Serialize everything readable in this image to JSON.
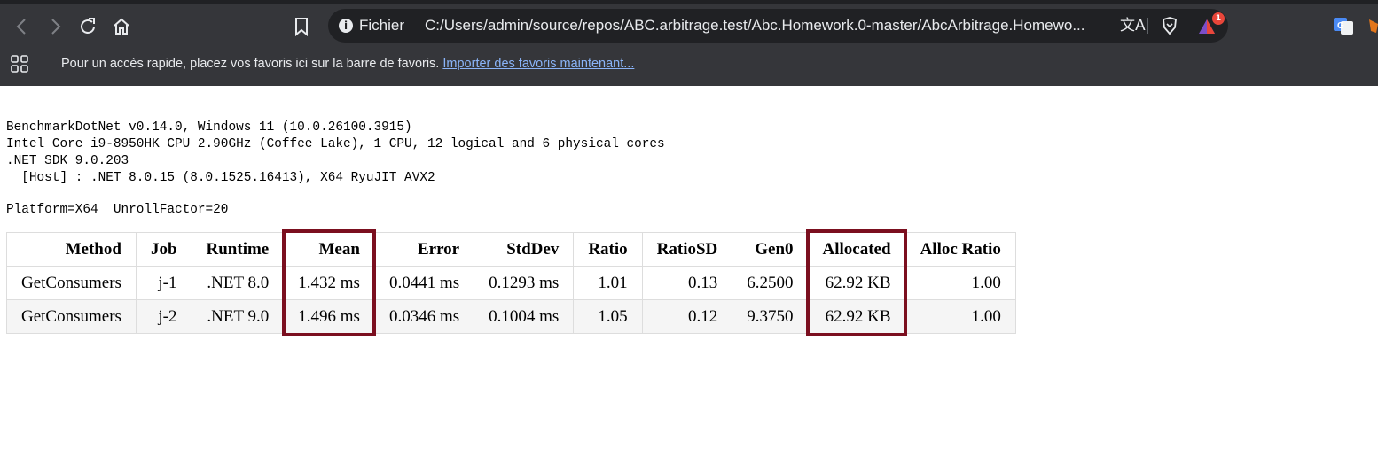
{
  "browser": {
    "address_bar": {
      "scheme_label": "Fichier",
      "url": "C:/Users/admin/source/repos/ABC.arbitrage.test/Abc.Homework.0-master/AbcArbitrage.Homewo...",
      "rewards_badge": "1"
    },
    "bookmarks_bar": {
      "message": "Pour un accès rapide, placez vos favoris ici sur la barre de favoris.",
      "import_link": "Importer des favoris maintenant..."
    },
    "icons": [
      "back-icon",
      "forward-icon",
      "reload-icon",
      "home-icon",
      "bookmark-icon",
      "info-icon",
      "translate-icon",
      "brave-shields-icon",
      "brave-rewards-icon",
      "google-translate-extension-icon",
      "metamask-extension-icon",
      "apps-icon"
    ],
    "colors": {
      "toolbar": "#35363a",
      "omnibox": "#202124",
      "link": "#8ab4f8",
      "highlight_box": "#7b0f1f"
    }
  },
  "report": {
    "environment": "BenchmarkDotNet v0.14.0, Windows 11 (10.0.26100.3915)\nIntel Core i9-8950HK CPU 2.90GHz (Coffee Lake), 1 CPU, 12 logical and 6 physical cores\n.NET SDK 9.0.203\n  [Host] : .NET 8.0.15 (8.0.1525.16413), X64 RyuJIT AVX2",
    "parameters": "Platform=X64  UnrollFactor=20",
    "table": {
      "headers": [
        "Method",
        "Job",
        "Runtime",
        "Mean",
        "Error",
        "StdDev",
        "Ratio",
        "RatioSD",
        "Gen0",
        "Allocated",
        "Alloc Ratio"
      ],
      "rows": [
        [
          "GetConsumers",
          "j-1",
          ".NET 8.0",
          "1.432 ms",
          "0.0441 ms",
          "0.1293 ms",
          "1.01",
          "0.13",
          "6.2500",
          "62.92 KB",
          "1.00"
        ],
        [
          "GetConsumers",
          "j-2",
          ".NET 9.0",
          "1.496 ms",
          "0.0346 ms",
          "0.1004 ms",
          "1.05",
          "0.12",
          "9.3750",
          "62.92 KB",
          "1.00"
        ]
      ],
      "highlighted_columns": [
        "Mean",
        "Allocated"
      ]
    }
  }
}
